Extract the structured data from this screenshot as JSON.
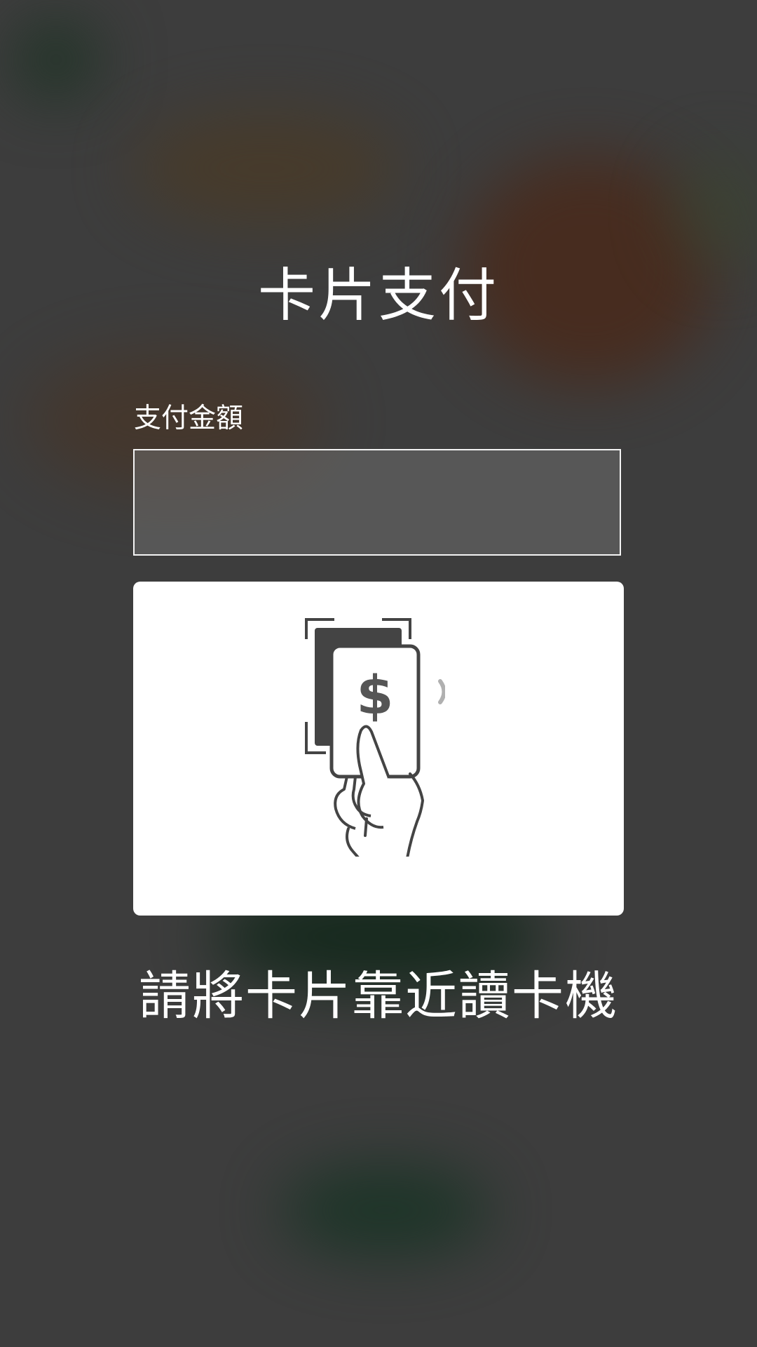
{
  "screen": {
    "title": "卡片支付",
    "amount_label": "支付金額",
    "amount_value": "",
    "instruction": "請將卡片靠近讀卡機"
  },
  "icons": {
    "tap_card": "contactless-card-tap-icon",
    "currency_symbol": "$"
  },
  "colors": {
    "illustration_dark": "#444444",
    "illustration_wave": "#b0b0b0",
    "panel_background": "#ffffff",
    "overlay_background": "#3f3f3f"
  }
}
